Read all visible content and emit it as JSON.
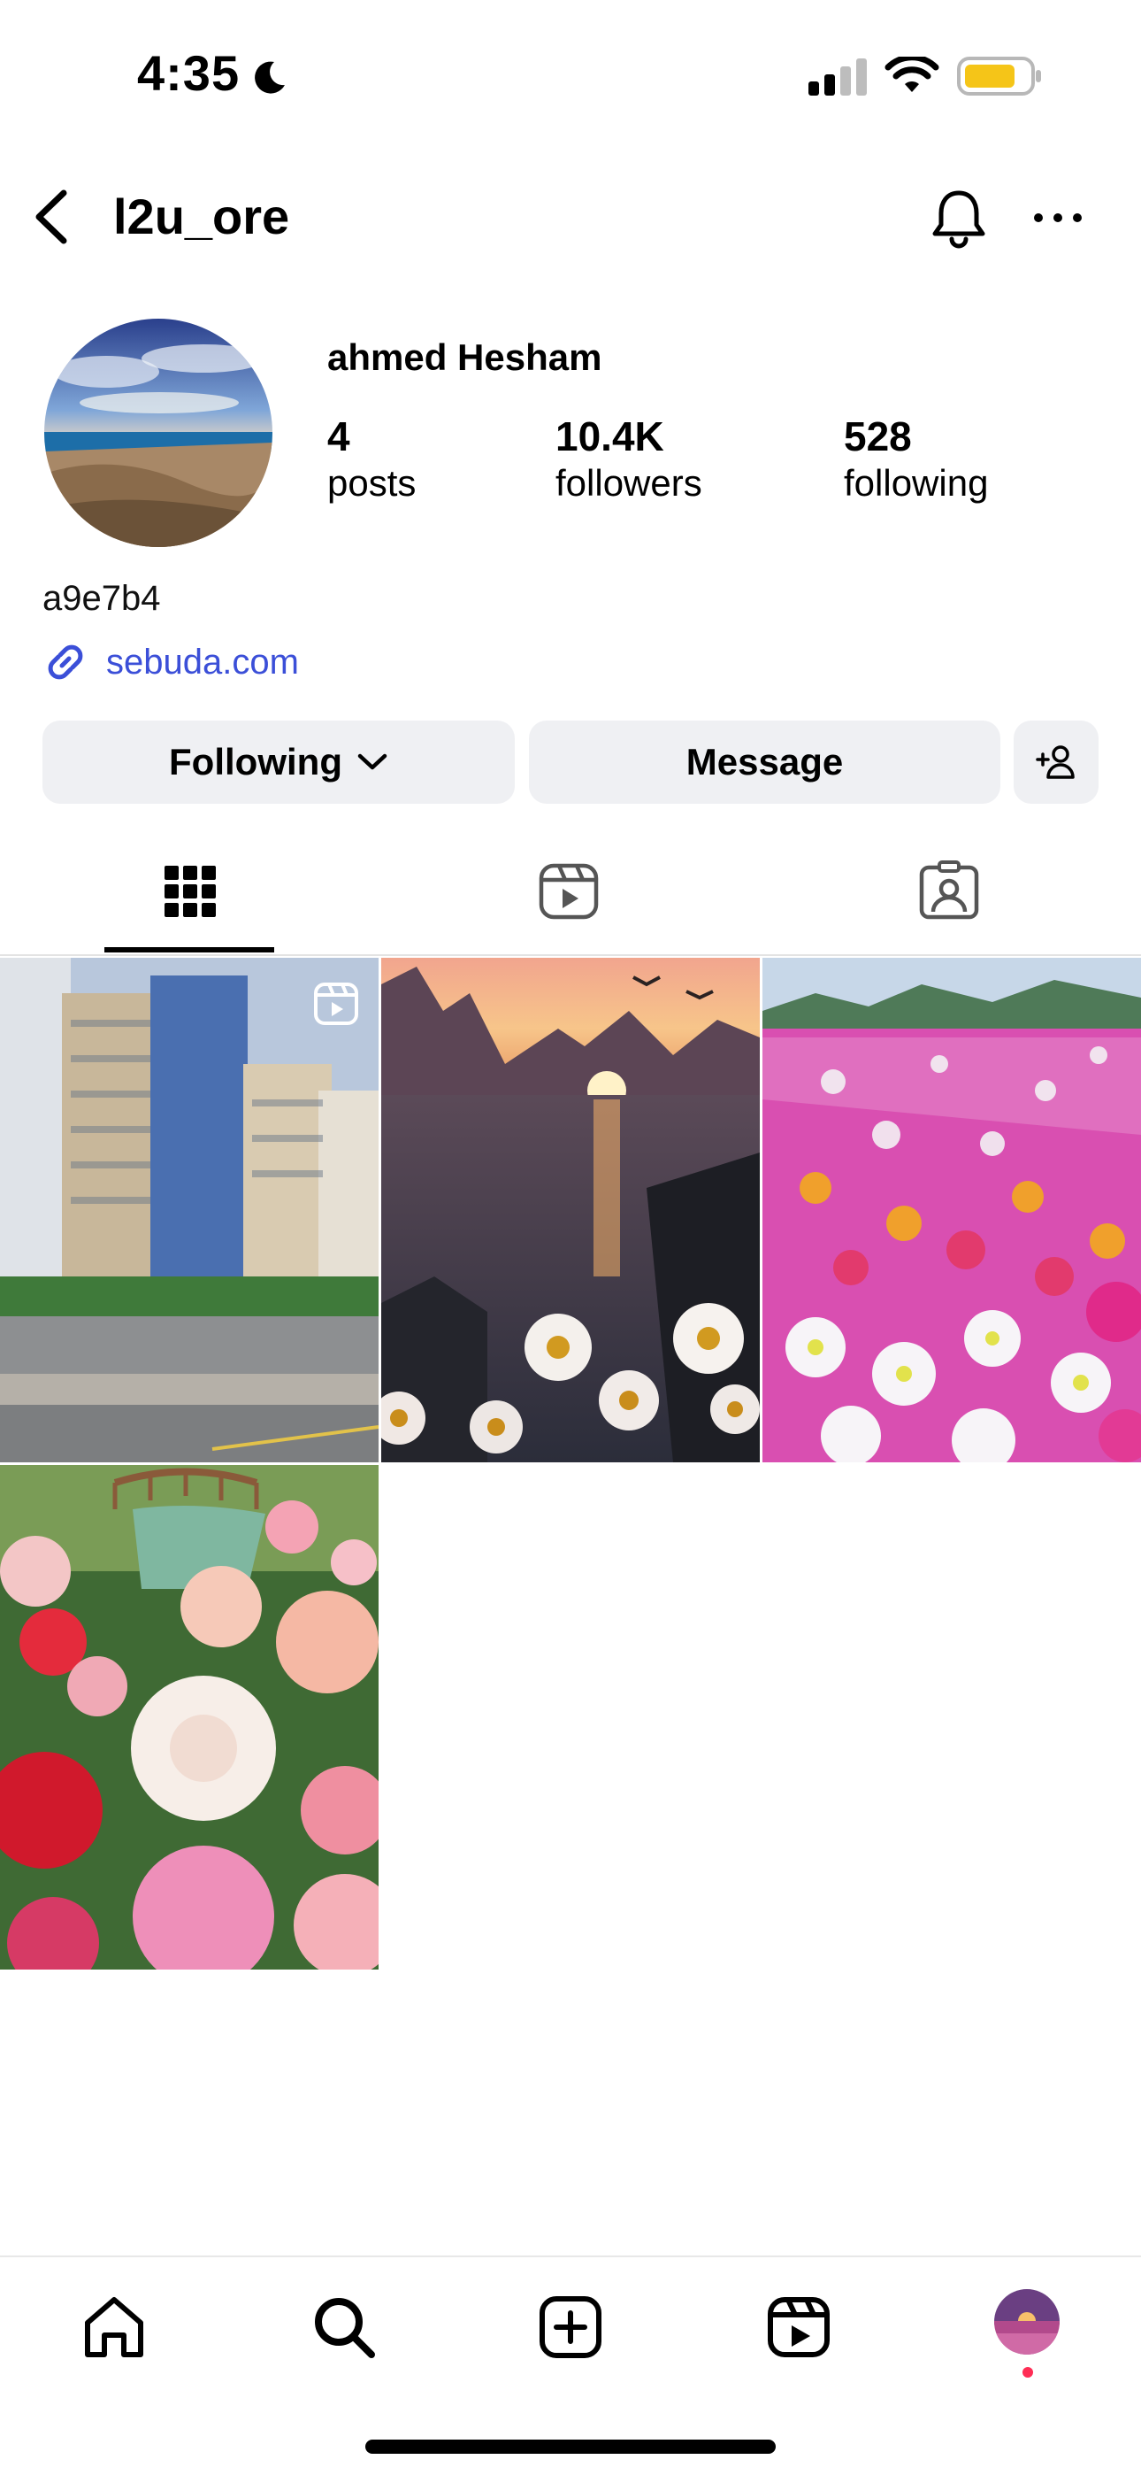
{
  "status_bar": {
    "time": "4:35",
    "icons": [
      "moon-icon",
      "cellular-signal-icon",
      "wifi-icon",
      "battery-icon"
    ],
    "battery_color": "#f5c518"
  },
  "header": {
    "username": "l2u_ore",
    "icons": [
      "back-arrow-icon",
      "bell-icon",
      "more-icon"
    ]
  },
  "profile": {
    "display_name": "ahmed Hesham",
    "stats": {
      "posts": {
        "value": "4",
        "label": "posts"
      },
      "followers": {
        "value": "10.4K",
        "label": "followers"
      },
      "following": {
        "value": "528",
        "label": "following"
      }
    },
    "bio": "a9e7b4",
    "link": "sebuda.com",
    "link_color": "#3b4fd8"
  },
  "actions": {
    "following_label": "Following",
    "message_label": "Message",
    "add_person_icon": "add-person-icon"
  },
  "tabs": [
    {
      "icon": "grid-icon",
      "active": true
    },
    {
      "icon": "reels-icon",
      "active": false
    },
    {
      "icon": "tagged-icon",
      "active": false
    }
  ],
  "posts": [
    {
      "subject": "city buildings street",
      "is_reel": true
    },
    {
      "subject": "sunset lake daisies",
      "is_reel": false
    },
    {
      "subject": "flower field",
      "is_reel": false
    },
    {
      "subject": "roses garden bridge",
      "is_reel": false
    }
  ],
  "bottom_nav": [
    "home-icon",
    "search-icon",
    "create-icon",
    "reels-icon",
    "profile-avatar"
  ],
  "colors": {
    "button_bg": "#eff0f3",
    "notification_dot": "#ff2d55"
  }
}
